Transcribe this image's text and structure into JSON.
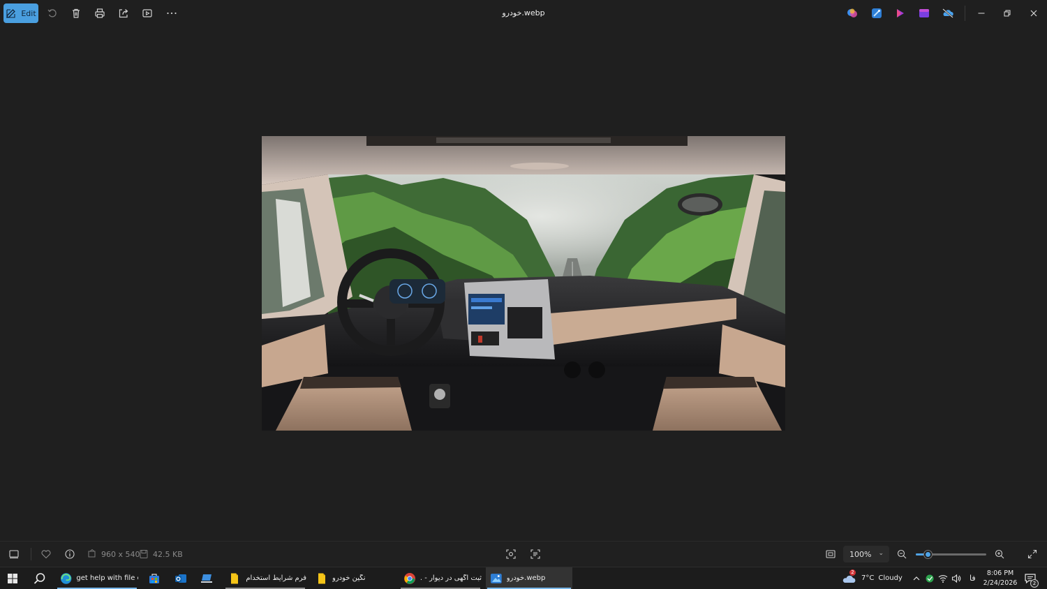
{
  "app": {
    "title": "خودرو.webp",
    "edit_label": "Edit"
  },
  "toolbar_icons": [
    "rotate-icon",
    "delete-icon",
    "print-icon",
    "share-icon",
    "slideshow-icon",
    "more-icon"
  ],
  "title_right_icons": [
    "copilot-icon",
    "photos-editor-icon",
    "clipchamp-icon",
    "designer-icon",
    "onedrive-off-icon"
  ],
  "status": {
    "dimensions": "960 x 540",
    "filesize": "42.5 KB",
    "zoom": "100%",
    "zoom_fraction": 0.17
  },
  "taskbar": {
    "items": [
      {
        "label": "get help with file ex...",
        "icon": "edge-icon"
      },
      {
        "label": "",
        "icon": "store-icon"
      },
      {
        "label": "",
        "icon": "outlook-icon"
      },
      {
        "label": "",
        "icon": "laptop-app-icon"
      },
      {
        "label": "فرم شرایط استخدام ...",
        "icon": "file-icon"
      },
      {
        "label": "نگین خودرو",
        "icon": "folder-icon"
      },
      {
        "label": "ثبت آگهی در دیوار - ...",
        "icon": "chrome-icon"
      },
      {
        "label": "خودرو.webp",
        "icon": "photos-icon"
      }
    ],
    "weather_temp": "7°C",
    "weather_desc": "Cloudy",
    "weather_badge": "2",
    "language": "فا",
    "time": "8:06 PM",
    "date": "2/24/2026",
    "notif_count": "2"
  },
  "colors": {
    "accent": "#4a9fe0",
    "background": "#1f1f1f"
  }
}
